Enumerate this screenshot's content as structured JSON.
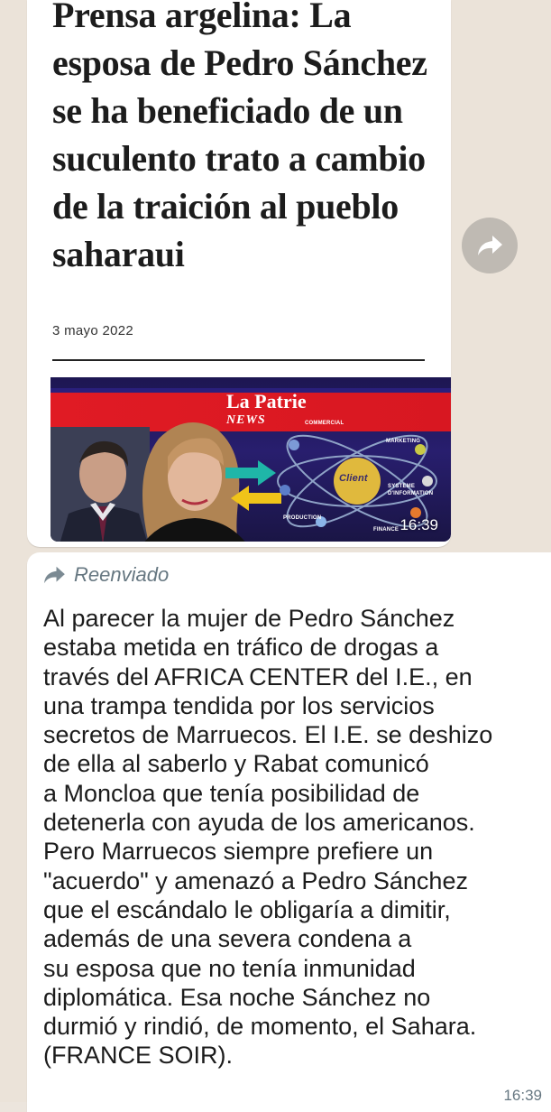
{
  "article": {
    "headline": "Prensa argelina: La esposa de Pedro Sánchez se ha beneficiado de un suculento trato a cambio de la traición al pueblo saharaui",
    "date": "3 mayo 2022",
    "banner_logo": "La Patrie",
    "banner_logo_sub": "NEWS",
    "atom_labels": [
      "COMMERCIAL",
      "MARKETING",
      "Client",
      "SYSTEME D'INFORMATION",
      "PRODUCTION",
      "FINANCE"
    ],
    "image_time": "16:39"
  },
  "message": {
    "forwarded_label": "Reenviado",
    "body": "Al parecer la mujer de Pedro Sánchez\nestaba metida en tráfico de drogas a\ntravés del AFRICA CENTER del I.E., en\nuna trampa tendida por los servicios\nsecretos de Marruecos. El I.E. se deshizo\nde ella al saberlo y Rabat comunicó\na Moncloa que tenía posibilidad de\ndetenerla con ayuda de los americanos.\nPero Marruecos siempre prefiere un\n\"acuerdo\" y amenazó a Pedro Sánchez\nque el escándalo le obligaría a dimitir,\nademás de una severa condena a\nsu esposa que no tenía inmunidad\ndiplomática. Esa noche Sánchez no\ndurmió y rindió, de momento, el Sahara.\n(FRANCE SOIR).",
    "time": "16:39"
  },
  "icons": {
    "forward_fab": "forward-arrow-icon",
    "forwarded": "forward-arrow-icon"
  },
  "colors": {
    "chat_background": "#ebe3d9",
    "bubble": "#ffffff",
    "meta_text": "#667781",
    "banner_red": "#e01b24",
    "banner_blue": "#281e6e"
  }
}
